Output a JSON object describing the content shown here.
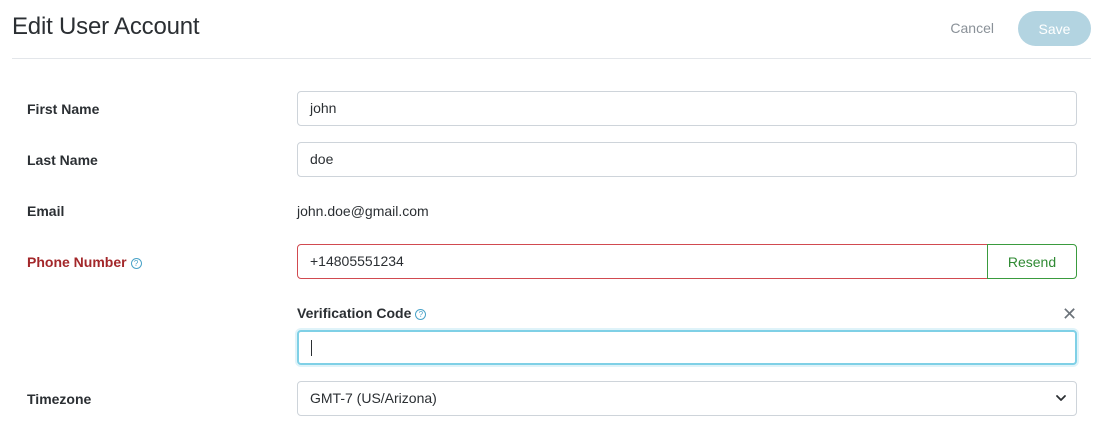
{
  "header": {
    "title": "Edit User Account",
    "cancel_label": "Cancel",
    "save_label": "Save"
  },
  "form": {
    "first_name": {
      "label": "First Name",
      "value": "john"
    },
    "last_name": {
      "label": "Last Name",
      "value": "doe"
    },
    "email": {
      "label": "Email",
      "value": "john.doe@gmail.com"
    },
    "phone": {
      "label": "Phone Number",
      "value": "+14805551234",
      "resend_label": "Resend",
      "help_icon": "?"
    },
    "verification": {
      "label": "Verification Code",
      "value": "",
      "help_icon": "?",
      "close_icon": "✕"
    },
    "timezone": {
      "label": "Timezone",
      "selected": "GMT-7 (US/Arizona)"
    }
  },
  "colors": {
    "error": "#a3272a",
    "success": "#2f8a33",
    "accent": "#7fd0e6",
    "save_disabled": "#b3d4e1"
  }
}
